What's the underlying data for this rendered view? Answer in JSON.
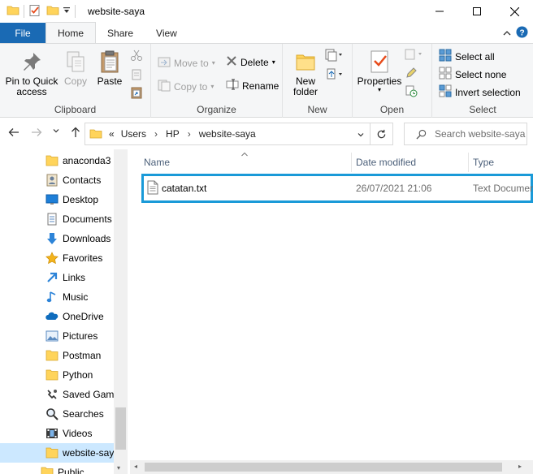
{
  "window": {
    "title": "website-saya"
  },
  "ribbon_tabs": [
    "File",
    "Home",
    "Share",
    "View"
  ],
  "ribbon": {
    "clipboard": {
      "label": "Clipboard",
      "pin": "Pin to Quick\naccess",
      "copy": "Copy",
      "paste": "Paste"
    },
    "organize": {
      "label": "Organize",
      "move_to": "Move to",
      "copy_to": "Copy to",
      "delete": "Delete",
      "rename": "Rename"
    },
    "new": {
      "label": "New",
      "new_folder": "New\nfolder"
    },
    "open": {
      "label": "Open",
      "properties": "Properties"
    },
    "select": {
      "label": "Select",
      "select_all": "Select all",
      "select_none": "Select none",
      "invert": "Invert selection"
    }
  },
  "address": {
    "overflow": "«",
    "crumbs": [
      "Users",
      "HP",
      "website-saya"
    ],
    "search_placeholder": "Search website-saya"
  },
  "nav_items": [
    {
      "label": "anaconda3",
      "icon": "folder-icon"
    },
    {
      "label": "Contacts",
      "icon": "contacts-icon"
    },
    {
      "label": "Desktop",
      "icon": "desktop-icon"
    },
    {
      "label": "Documents",
      "icon": "documents-icon"
    },
    {
      "label": "Downloads",
      "icon": "downloads-icon"
    },
    {
      "label": "Favorites",
      "icon": "star-icon"
    },
    {
      "label": "Links",
      "icon": "links-icon"
    },
    {
      "label": "Music",
      "icon": "music-icon"
    },
    {
      "label": "OneDrive",
      "icon": "cloud-icon"
    },
    {
      "label": "Pictures",
      "icon": "pictures-icon"
    },
    {
      "label": "Postman",
      "icon": "folder-icon"
    },
    {
      "label": "Python",
      "icon": "folder-icon"
    },
    {
      "label": "Saved Games",
      "icon": "saved-games-icon"
    },
    {
      "label": "Searches",
      "icon": "search-icon"
    },
    {
      "label": "Videos",
      "icon": "videos-icon"
    },
    {
      "label": "website-saya",
      "icon": "folder-icon"
    },
    {
      "label": "Public",
      "icon": "folder-icon"
    }
  ],
  "columns": {
    "name": "Name",
    "date": "Date modified",
    "type": "Type"
  },
  "files": [
    {
      "name": "catatan.txt",
      "date": "26/07/2021 21:06",
      "type": "Text Document"
    }
  ],
  "colors": {
    "file_tab": "#1a6ab4",
    "selection_outline": "#1a9ad8",
    "folder": "#ffd45b"
  }
}
